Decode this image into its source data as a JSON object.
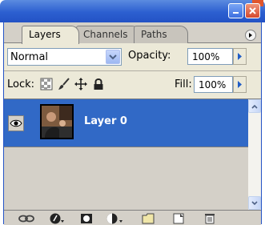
{
  "window": {
    "titlebar_color": "#2c5fd0",
    "buttons": [
      "minimize-icon",
      "close-icon"
    ]
  },
  "tabs": [
    {
      "label": "Layers",
      "active": true
    },
    {
      "label": "Channels",
      "active": false
    },
    {
      "label": "Paths",
      "active": false
    }
  ],
  "blend": {
    "mode": "Normal",
    "opacity_label": "Opacity:",
    "opacity_value": "100%"
  },
  "lock": {
    "label": "Lock:",
    "icons": [
      "transparency-lock-icon",
      "brush-lock-icon",
      "move-lock-icon",
      "padlock-icon"
    ],
    "fill_label": "Fill:",
    "fill_value": "100%"
  },
  "layers": [
    {
      "name": "Layer 0",
      "visible": true,
      "selected": true
    }
  ],
  "colors": {
    "selection": "#3169c6",
    "panel": "#d4d0c8"
  },
  "bottom_icons": [
    "link-layers-icon",
    "layer-style-icon",
    "layer-mask-icon",
    "adjustment-layer-icon",
    "new-group-icon",
    "new-layer-icon",
    "trash-icon"
  ]
}
